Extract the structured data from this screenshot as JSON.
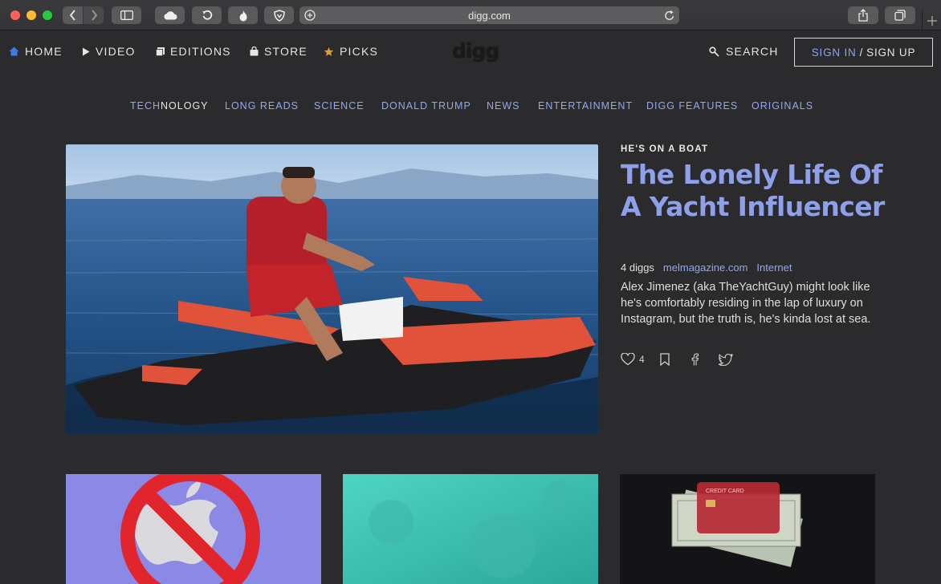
{
  "browser": {
    "url": "digg.com"
  },
  "nav": {
    "items": [
      {
        "label": "HOME",
        "icon": "home-icon"
      },
      {
        "label": "VIDEO",
        "icon": "play-icon"
      },
      {
        "label": "EDITIONS",
        "icon": "editions-icon"
      },
      {
        "label": "STORE",
        "icon": "bag-icon"
      },
      {
        "label": "PICKS",
        "icon": "star-icon"
      }
    ],
    "logo": "digg",
    "search_label": "SEARCH",
    "signin_label": "SIGN IN",
    "signin_sep": "/",
    "signup_label": "SIGN UP"
  },
  "categories": [
    {
      "label_highlight": "TECH",
      "label_rest": "NOLOGY"
    },
    {
      "label_highlight": "LONG READS",
      "label_rest": ""
    },
    {
      "label_highlight": "SCIENCE",
      "label_rest": ""
    },
    {
      "label_highlight": "DONALD TRUMP",
      "label_rest": ""
    },
    {
      "label_highlight": "NEWS",
      "label_rest": ""
    },
    {
      "label_highlight": "ENTERTAINMENT",
      "label_rest": ""
    },
    {
      "label_highlight": "DIGG FEATURES",
      "label_rest": ""
    },
    {
      "label_highlight": "ORIGINALS",
      "label_rest": ""
    }
  ],
  "feature": {
    "kicker": "HE'S ON A BOAT",
    "headline": "The Lonely Life Of A Yacht Influencer",
    "diggs": "4 diggs",
    "source": "melmagazine.com",
    "tag": "Internet",
    "description": "Alex Jimenez (aka TheYachtGuy) might look like he's comfortably residing in the lap of luxury on Instagram, but the truth is, he's kinda lost at sea.",
    "like_count": "4"
  },
  "cards": [
    {
      "image": "no-apple-image"
    },
    {
      "image": "underwater-image"
    },
    {
      "image": "credit-card-money-image",
      "card_text": "CREDIT CARD"
    }
  ],
  "colors": {
    "accent": "#8fa0ea",
    "background": "#2b2b2d",
    "home_icon": "#3d7de8",
    "picks_star": "#e39a3c"
  }
}
